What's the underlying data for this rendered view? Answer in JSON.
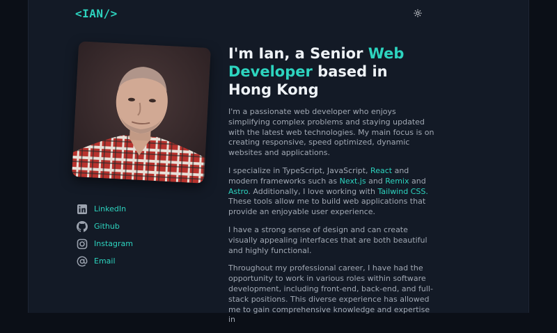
{
  "header": {
    "logo": "<IAN/>",
    "theme_toggle_icon": "sun-icon"
  },
  "hero": {
    "title_part1": "I'm Ian, a Senior ",
    "title_accent": "Web Developer",
    "title_part2": " based in Hong Kong"
  },
  "about": {
    "p1": "I'm a passionate web developer who enjoys simplifying complex problems and staying updated with the latest web technologies. My main focus is on creating responsive, speed optimized, dynamic websites and applications.",
    "p2_a": "I specialize in TypeScript, JavaScript, ",
    "p2_react": "React",
    "p2_b": " and modern frameworks such as ",
    "p2_next": "Next.js",
    "p2_c": " and ",
    "p2_remix": "Remix",
    "p2_d": " and ",
    "p2_astro": "Astro",
    "p2_e": ". Additionally, I love working with ",
    "p2_tailwind": "Tailwind CSS.",
    "p2_f": " These tools allow me to build web applications that provide an enjoyable user experience.",
    "p3": "I have a strong sense of design and can create visually appealing interfaces that are both beautiful and highly functional.",
    "p4": "Throughout my professional career, I have had the opportunity to work in various roles within software development, including front-end, back-end, and full-stack positions. This diverse experience has allowed me to gain comprehensive knowledge and expertise in"
  },
  "social": [
    {
      "label": "LinkedIn",
      "icon": "linkedin-icon"
    },
    {
      "label": "Github",
      "icon": "github-icon"
    },
    {
      "label": "Instagram",
      "icon": "instagram-icon"
    },
    {
      "label": "Email",
      "icon": "at-sign-icon"
    }
  ],
  "colors": {
    "accent": "#2dd4bf",
    "background": "#131a26",
    "heading": "#eef2f6",
    "body_text": "#a1a8b3"
  }
}
